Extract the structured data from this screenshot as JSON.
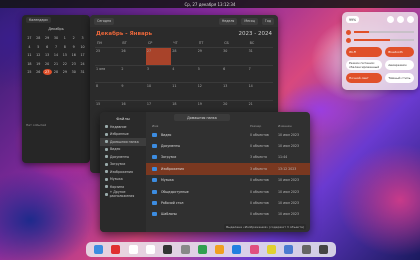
{
  "topbar": {
    "datetime": "Ср, 27 декабря 13:12:34"
  },
  "mini_calendar": {
    "today_btn": "Календари",
    "month": "Декабрь",
    "days": [
      "27",
      "28",
      "29",
      "30",
      "1",
      "2",
      "3",
      "4",
      "5",
      "6",
      "7",
      "8",
      "9",
      "10",
      "11",
      "12",
      "13",
      "14",
      "15",
      "16",
      "17",
      "18",
      "19",
      "20",
      "21",
      "22",
      "23",
      "24",
      "25",
      "26",
      "27",
      "28",
      "29",
      "30",
      "31"
    ],
    "today": "27",
    "footer": "Нет событий"
  },
  "calendar": {
    "toolbar": {
      "today": "Сегодня",
      "week": "Неделя",
      "month": "Месяц",
      "year": "Год"
    },
    "title": "Декабрь - Январь",
    "years": "2023 - 2024",
    "weekdays": [
      "ПН",
      "ВТ",
      "СР",
      "ЧТ",
      "ПТ",
      "СБ",
      "ВС"
    ],
    "cells": [
      "25",
      "26",
      "27",
      "28",
      "29",
      "30",
      "31",
      "1 янв",
      "2",
      "3",
      "4",
      "5",
      "6",
      "7",
      "8",
      "9",
      "10",
      "11",
      "12",
      "13",
      "14",
      "15",
      "16",
      "17",
      "18",
      "19",
      "20",
      "21"
    ]
  },
  "files": {
    "title": "Файлы",
    "path": "Домашняя папка",
    "columns": {
      "name": "Имя",
      "size": "Размер",
      "modified": "Изменён"
    },
    "sidebar": [
      {
        "label": "Недавние",
        "icon": "clock-icon"
      },
      {
        "label": "Избранные",
        "icon": "star-icon"
      },
      {
        "label": "Домашняя папка",
        "icon": "home-icon"
      },
      {
        "label": "Видео",
        "icon": "video-icon"
      },
      {
        "label": "Документы",
        "icon": "document-icon"
      },
      {
        "label": "Загрузки",
        "icon": "download-icon"
      },
      {
        "label": "Изображения",
        "icon": "image-icon"
      },
      {
        "label": "Музыка",
        "icon": "music-icon"
      },
      {
        "label": "Корзина",
        "icon": "trash-icon"
      },
      {
        "label": "+ Другие расположения",
        "icon": "plus-icon"
      }
    ],
    "rows": [
      {
        "name": "Видео",
        "size": "0 объектов",
        "date": "10 июл 2023"
      },
      {
        "name": "Документы",
        "size": "0 объектов",
        "date": "10 июл 2023"
      },
      {
        "name": "Загрузки",
        "size": "3 объекта",
        "date": "11:44"
      },
      {
        "name": "Изображения",
        "size": "3 объекта",
        "date": "13:12 2023"
      },
      {
        "name": "Музыка",
        "size": "0 объектов",
        "date": "10 июл 2023"
      },
      {
        "name": "Общедоступные",
        "size": "0 объектов",
        "date": "10 июл 2023"
      },
      {
        "name": "Рабочий стол",
        "size": "0 объектов",
        "date": "10 июл 2023"
      },
      {
        "name": "Шаблоны",
        "size": "0 объектов",
        "date": "10 июл 2023"
      }
    ],
    "status": "Выделена «Изображения» (содержит 3 объекта)"
  },
  "quick_settings": {
    "battery": "99%",
    "brightness": 0.25,
    "volume": 0.6,
    "toggles": [
      {
        "label": "Wi-Fi",
        "on": true
      },
      {
        "label": "Bluetooth",
        "on": true
      },
      {
        "label": "Режим питания: сбалансированный",
        "on": false
      },
      {
        "label": "Авиарежим",
        "on": false
      },
      {
        "label": "Ночной свет",
        "on": true
      },
      {
        "label": "Тёмный стиль",
        "on": false
      }
    ]
  },
  "dock": {
    "apps": [
      {
        "name": "files-icon",
        "color": "#3c8ce0"
      },
      {
        "name": "yandex-icon",
        "color": "#e03030"
      },
      {
        "name": "mail-icon",
        "color": "#ffffff"
      },
      {
        "name": "calendar-icon",
        "color": "#ffffff"
      },
      {
        "name": "terminal-icon",
        "color": "#333333"
      },
      {
        "name": "settings-icon",
        "color": "#888888"
      },
      {
        "name": "chart-icon",
        "color": "#30a050"
      },
      {
        "name": "weather-icon",
        "color": "#f0a020"
      },
      {
        "name": "camera-icon",
        "color": "#2080e0"
      },
      {
        "name": "music-icon",
        "color": "#e05080"
      },
      {
        "name": "photos-icon",
        "color": "#e0d030"
      },
      {
        "name": "store-icon",
        "color": "#4a7ad0"
      },
      {
        "name": "disks-icon",
        "color": "#666666"
      },
      {
        "name": "apps-grid-icon",
        "color": "#444444"
      }
    ]
  }
}
